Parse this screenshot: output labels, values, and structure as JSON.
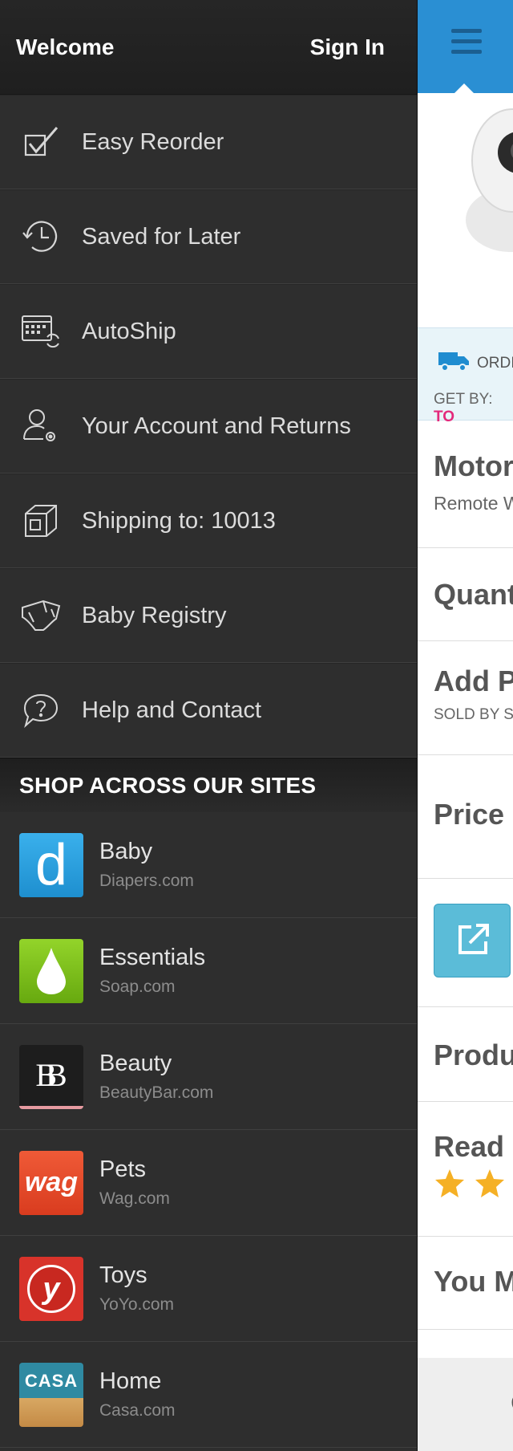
{
  "drawer": {
    "welcome": "Welcome",
    "sign_in": "Sign In",
    "menu": [
      {
        "label": "Easy Reorder",
        "icon": "checkbox-icon"
      },
      {
        "label": "Saved for Later",
        "icon": "history-clock-icon"
      },
      {
        "label": "AutoShip",
        "icon": "calendar-refresh-icon"
      },
      {
        "label": "Your Account and Returns",
        "icon": "user-settings-icon"
      },
      {
        "label": "Shipping to: 10013",
        "icon": "box-icon"
      },
      {
        "label": "Baby Registry",
        "icon": "diaper-icon"
      },
      {
        "label": "Help and Contact",
        "icon": "help-bubble-icon"
      }
    ],
    "section_title": "SHOP ACROSS OUR SITES",
    "sites": [
      {
        "name": "Baby",
        "domain": "Diapers.com",
        "logo_text": "d",
        "color": "#2d9fe0"
      },
      {
        "name": "Essentials",
        "domain": "Soap.com",
        "logo_text": "",
        "color": "#7cc11c"
      },
      {
        "name": "Beauty",
        "domain": "BeautyBar.com",
        "logo_text": "BB",
        "color": "#1e1e1e"
      },
      {
        "name": "Pets",
        "domain": "Wag.com",
        "logo_text": "wag",
        "color": "#e84a2a"
      },
      {
        "name": "Toys",
        "domain": "YoYo.com",
        "logo_text": "y",
        "color": "#d8332a"
      },
      {
        "name": "Home",
        "domain": "Casa.com",
        "logo_text": "CASA",
        "color": "#2e7f95"
      }
    ]
  },
  "page": {
    "ship_label": "ORDI",
    "get_by_label": "GET BY:",
    "get_by_value": "TO",
    "product_title": "Motor",
    "product_subtitle": "Remote W",
    "quantity": "Quant",
    "add_protection": "Add P",
    "sold_by": "SOLD BY S",
    "price": "Price",
    "product_details": "Produ",
    "read_reviews": "Read",
    "you_may": "You M",
    "footer_char": "C",
    "accent_color": "#2a8fd3",
    "rating_stars_visible": 2
  }
}
